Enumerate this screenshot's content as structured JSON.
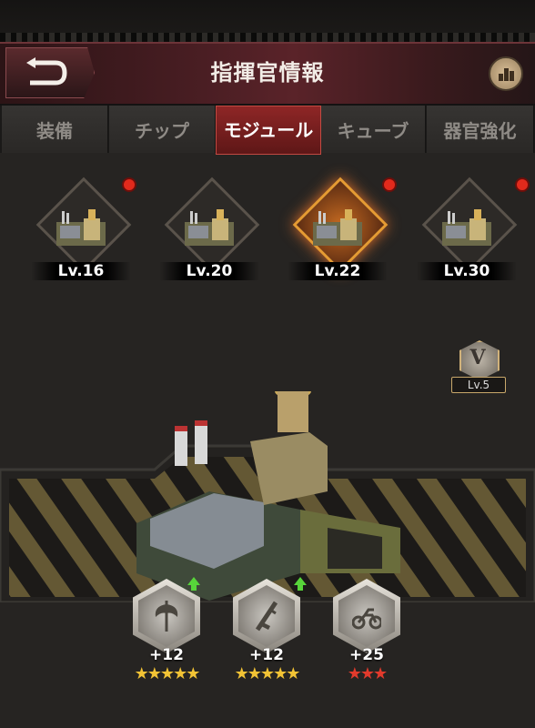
{
  "header": {
    "title": "指揮官情報",
    "back_icon": "back-arrow-icon",
    "stats_icon": "bar-chart-icon"
  },
  "tabs": [
    {
      "label": "装備",
      "active": false
    },
    {
      "label": "チップ",
      "active": false
    },
    {
      "label": "モジュール",
      "active": true
    },
    {
      "label": "キューブ",
      "active": false
    },
    {
      "label": "器官強化",
      "active": false
    }
  ],
  "modules": [
    {
      "level": "Lv.16",
      "selected": false,
      "notification": true
    },
    {
      "level": "Lv.20",
      "selected": false,
      "notification": false
    },
    {
      "level": "Lv.22",
      "selected": true,
      "notification": true
    },
    {
      "level": "Lv.30",
      "selected": false,
      "notification": true
    }
  ],
  "rank_badge": {
    "numeral": "V",
    "level": "Lv.5"
  },
  "stats": [
    {
      "icon": "axe-icon",
      "value": "+12",
      "stars": "★★★★★",
      "star_color": "#f2c335",
      "upgrade": true
    },
    {
      "icon": "rifle-icon",
      "value": "+12",
      "stars": "★★★★★",
      "star_color": "#f2c335",
      "upgrade": true
    },
    {
      "icon": "motorcycle-icon",
      "value": "+25",
      "stars": "★★★",
      "star_color": "#e23a2c",
      "upgrade": false
    }
  ]
}
